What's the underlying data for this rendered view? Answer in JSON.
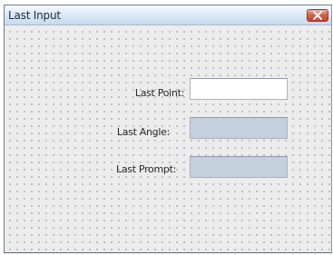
{
  "window": {
    "title": "Last Input"
  },
  "titlebar": {
    "close_icon": "close-icon",
    "close_color": "#d8614c"
  },
  "form": {
    "last_point": {
      "label": "Last Point:",
      "value": ""
    },
    "last_angle": {
      "label": "Last Angle:",
      "value": ""
    },
    "last_prompt": {
      "label": "Last Prompt:",
      "value": ""
    }
  },
  "colors": {
    "readonly_field": "#c5d0dd",
    "editable_field": "#ffffff"
  }
}
